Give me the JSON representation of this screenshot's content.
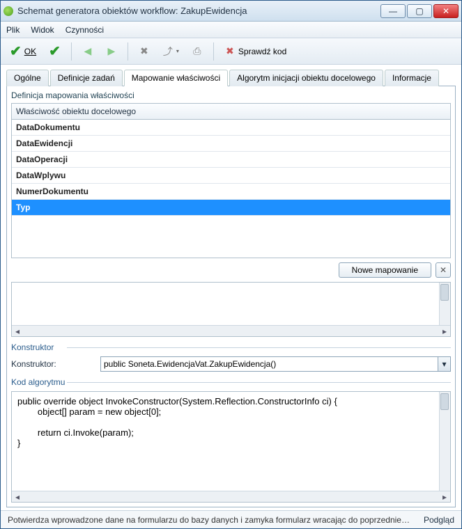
{
  "window": {
    "title": "Schemat generatora obiektów workflow: ZakupEwidencja"
  },
  "menu": {
    "file": "Plik",
    "view": "Widok",
    "actions": "Czynności"
  },
  "toolbar": {
    "ok": "OK",
    "check_code": "Sprawdź kod"
  },
  "tabs": {
    "general": "Ogólne",
    "task_defs": "Definicje zadań",
    "mapping": "Mapowanie właściwości",
    "init_algo": "Algorytm inicjacji obiektu docelowego",
    "info": "Informacje"
  },
  "mapping_panel": {
    "title": "Definicja mapowania właściwości",
    "column_header": "Właściwość obiektu docelowego",
    "rows": [
      "DataDokumentu",
      "DataEwidencji",
      "DataOperacji",
      "DataWplywu",
      "NumerDokumentu",
      "Typ"
    ],
    "selected_index": 5,
    "new_mapping": "Nowe mapowanie"
  },
  "constructor_section": {
    "legend": "Konstruktor",
    "label": "Konstruktor:",
    "value": "public Soneta.EwidencjaVat.ZakupEwidencja()"
  },
  "code_section": {
    "legend": "Kod algorytmu",
    "code": "public override object InvokeConstructor(System.Reflection.ConstructorInfo ci) {\n        object[] param = new object[0];\n\n        return ci.Invoke(param);\n}"
  },
  "status": {
    "message": "Potwierdza wprowadzone dane na formularzu do bazy danych i zamyka formularz wracając do poprzedniego fo...",
    "view": "Podgląd"
  }
}
